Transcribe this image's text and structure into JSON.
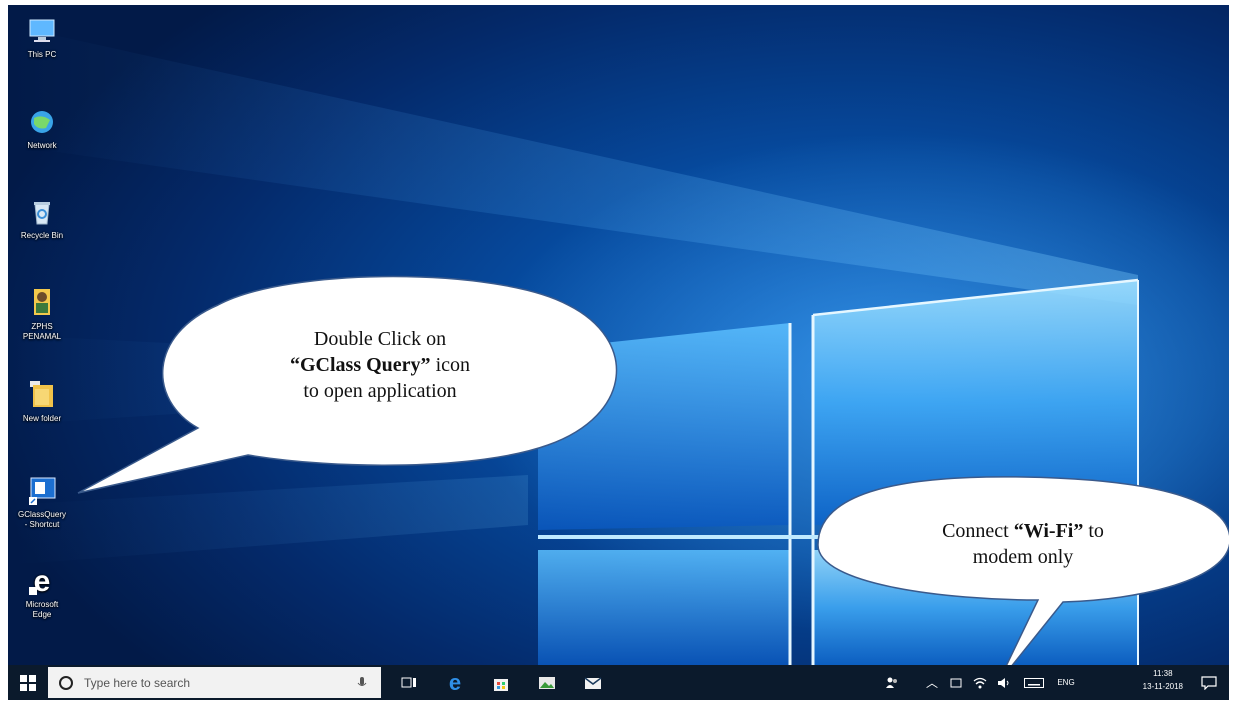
{
  "desktop": {
    "icons": [
      {
        "label": "This PC",
        "icon": "this-pc-icon"
      },
      {
        "label": "Network",
        "icon": "network-icon"
      },
      {
        "label": "Recycle Bin",
        "icon": "recycle-bin-icon"
      },
      {
        "label": "ZPHS\nPENAMAL",
        "icon": "user-folder-icon"
      },
      {
        "label": "New folder",
        "icon": "folder-icon"
      },
      {
        "label": "GClassQuery\n- Shortcut",
        "icon": "gclassquery-icon"
      },
      {
        "label": "Microsoft\nEdge",
        "icon": "edge-icon"
      }
    ]
  },
  "callouts": {
    "gclass": {
      "line1": "Double Click on",
      "bold": "“GClass Query”",
      "after_bold": " icon",
      "line3": "to open application"
    },
    "wifi": {
      "before_bold": "Connect ",
      "bold": "“Wi-Fi”",
      "after_bold": " to",
      "line2": "modem only"
    }
  },
  "taskbar": {
    "search_placeholder": "Type here to search",
    "language": "ENG",
    "time": "11:38",
    "date": "13-11-2018"
  },
  "colors": {
    "taskbar": "#0b1a2c",
    "wallpaper_accent": "#0a5fc4",
    "callout_fill": "#ffffff",
    "callout_stroke": "#3a5a8c"
  }
}
